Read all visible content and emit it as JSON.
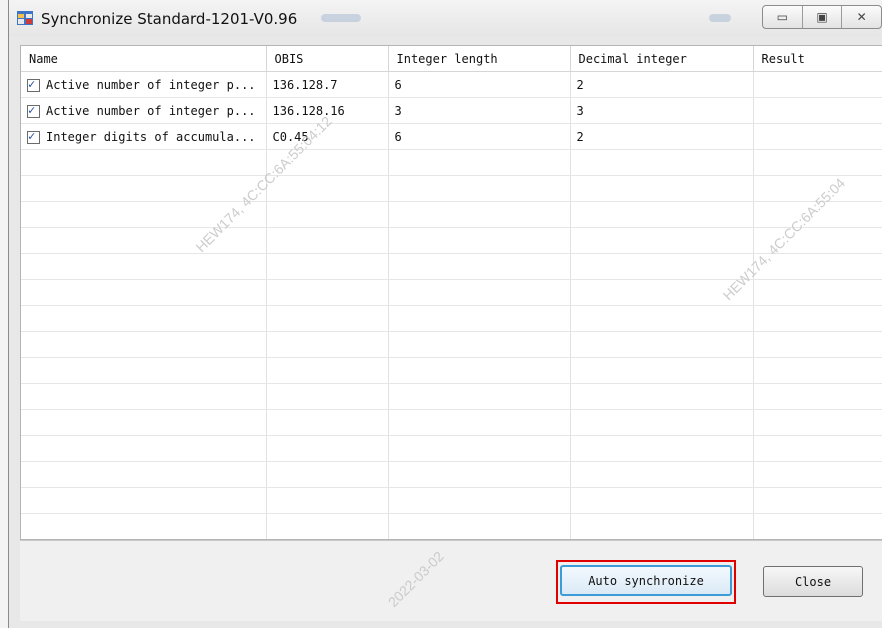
{
  "window": {
    "title": "Synchronize Standard-1201-V0.96",
    "controls": {
      "minimize": "▭",
      "maximize": "▣",
      "close": "✕"
    }
  },
  "table": {
    "headers": [
      "Name",
      "OBIS",
      "Integer length",
      "Decimal integer",
      "Result"
    ],
    "rows": [
      {
        "checked": true,
        "name": "Active number of integer p...",
        "obis": "136.128.7",
        "integer_length": "6",
        "decimal_integer": "2",
        "result": ""
      },
      {
        "checked": true,
        "name": "Active number of integer p...",
        "obis": "136.128.16",
        "integer_length": "3",
        "decimal_integer": "3",
        "result": ""
      },
      {
        "checked": true,
        "name": "Integer digits of accumula...",
        "obis": "C0.45",
        "integer_length": "6",
        "decimal_integer": "2",
        "result": ""
      }
    ]
  },
  "buttons": {
    "auto_sync": "Auto synchronize",
    "close": "Close"
  },
  "watermark": {
    "a": "HEW174, 4C:CC:6A:55:04:12",
    "b": "2022-03-02",
    "c": "HEW174, 4C:CC:6A:55:04"
  }
}
